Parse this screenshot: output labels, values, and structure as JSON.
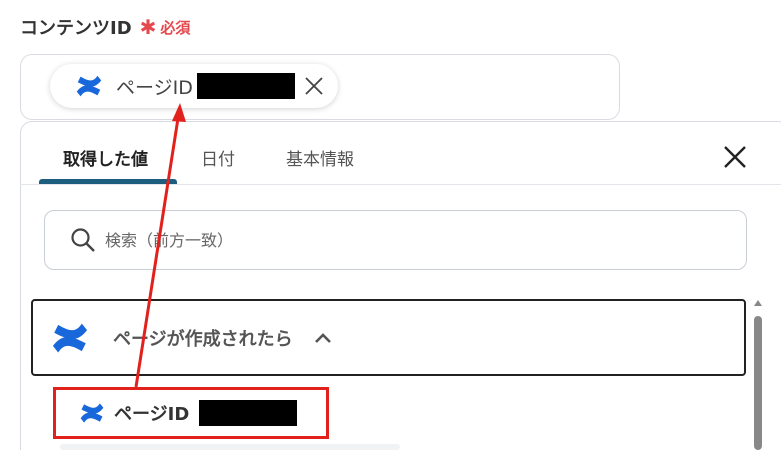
{
  "field": {
    "label": "コンテンツID",
    "required_mark": "✱",
    "required_text": "必須"
  },
  "chip": {
    "label": "ページID",
    "icon": "confluence-logo-icon",
    "remove_icon": "close-icon"
  },
  "tabs": [
    {
      "label": "取得した値",
      "active": true
    },
    {
      "label": "日付",
      "active": false
    },
    {
      "label": "基本情報",
      "active": false
    }
  ],
  "search": {
    "placeholder": "検索（前方一致）",
    "value": ""
  },
  "group": {
    "title": "ページが作成されたら",
    "expanded": true
  },
  "items": [
    {
      "label": "ページID"
    }
  ],
  "colors": {
    "required": "#e5484d",
    "tab_underline": "#1d5e7e",
    "confluence_blue": "#1868db",
    "highlight": "#e2211c"
  }
}
